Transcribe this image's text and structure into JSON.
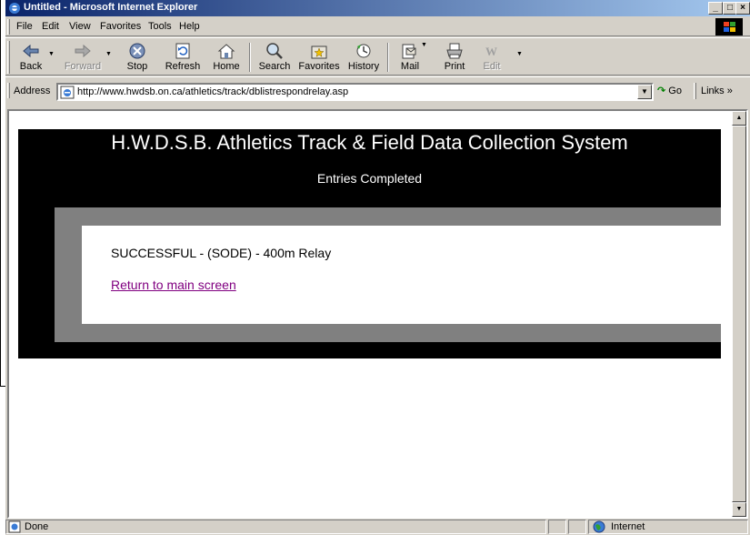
{
  "window": {
    "title": "Untitled - Microsoft Internet Explorer",
    "minimize": "_",
    "maximize": "□",
    "close": "×"
  },
  "menu": {
    "items": [
      {
        "label": "File"
      },
      {
        "label": "Edit"
      },
      {
        "label": "View"
      },
      {
        "label": "Favorites"
      },
      {
        "label": "Tools"
      },
      {
        "label": "Help"
      }
    ]
  },
  "toolbar": {
    "back": "Back",
    "forward": "Forward",
    "stop": "Stop",
    "refresh": "Refresh",
    "home": "Home",
    "search": "Search",
    "favorites": "Favorites",
    "history": "History",
    "mail": "Mail",
    "print": "Print",
    "edit": "Edit"
  },
  "address": {
    "label": "Address",
    "url": "http://www.hwdsb.on.ca/athletics/track/dblistrespondrelay.asp",
    "go": "Go",
    "links": "Links »"
  },
  "page": {
    "heading": "H.W.D.S.B. Athletics Track & Field Data Collection System",
    "subheading": "Entries Completed",
    "message": "SUCCESSFUL - (SODE) - 400m Relay",
    "return_link": "Return to main screen"
  },
  "status": {
    "text": "Done",
    "zone": "Internet"
  },
  "colors": {
    "titlebar_start": "#0a246a",
    "titlebar_end": "#a6caf0",
    "chrome": "#d4d0c8",
    "visited_link": "#800080",
    "panel_black": "#000000",
    "panel_gray": "#808080"
  }
}
